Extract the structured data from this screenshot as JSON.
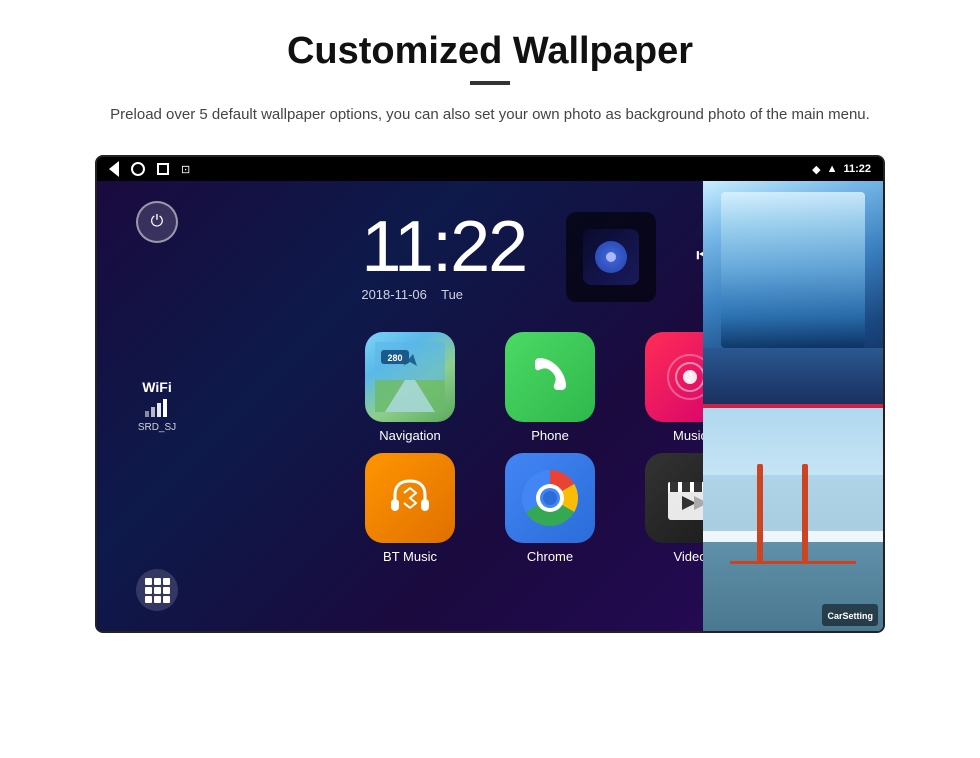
{
  "page": {
    "title": "Customized Wallpaper",
    "description": "Preload over 5 default wallpaper options, you can also set your own photo as background photo of the main menu."
  },
  "device": {
    "statusBar": {
      "time": "11:22",
      "icons": {
        "back": "◁",
        "home": "○",
        "recents": "□",
        "screenshot": "⊡",
        "location": "📍",
        "signal": "▲",
        "clock": "11:22"
      }
    },
    "clock": "11:22",
    "date": "2018-11-06",
    "day": "Tue",
    "wifi": {
      "label": "WiFi",
      "network": "SRD_SJ"
    },
    "apps": [
      {
        "id": "navigation",
        "label": "Navigation",
        "badge": "280"
      },
      {
        "id": "phone",
        "label": "Phone"
      },
      {
        "id": "music",
        "label": "Music"
      },
      {
        "id": "bt-music",
        "label": "BT Music"
      },
      {
        "id": "chrome",
        "label": "Chrome"
      },
      {
        "id": "video",
        "label": "Video"
      }
    ],
    "wallpapers": {
      "top_label": "Ice landscape",
      "bottom_label": "Golden Gate Bridge",
      "mini_label": "CarSetting"
    }
  }
}
